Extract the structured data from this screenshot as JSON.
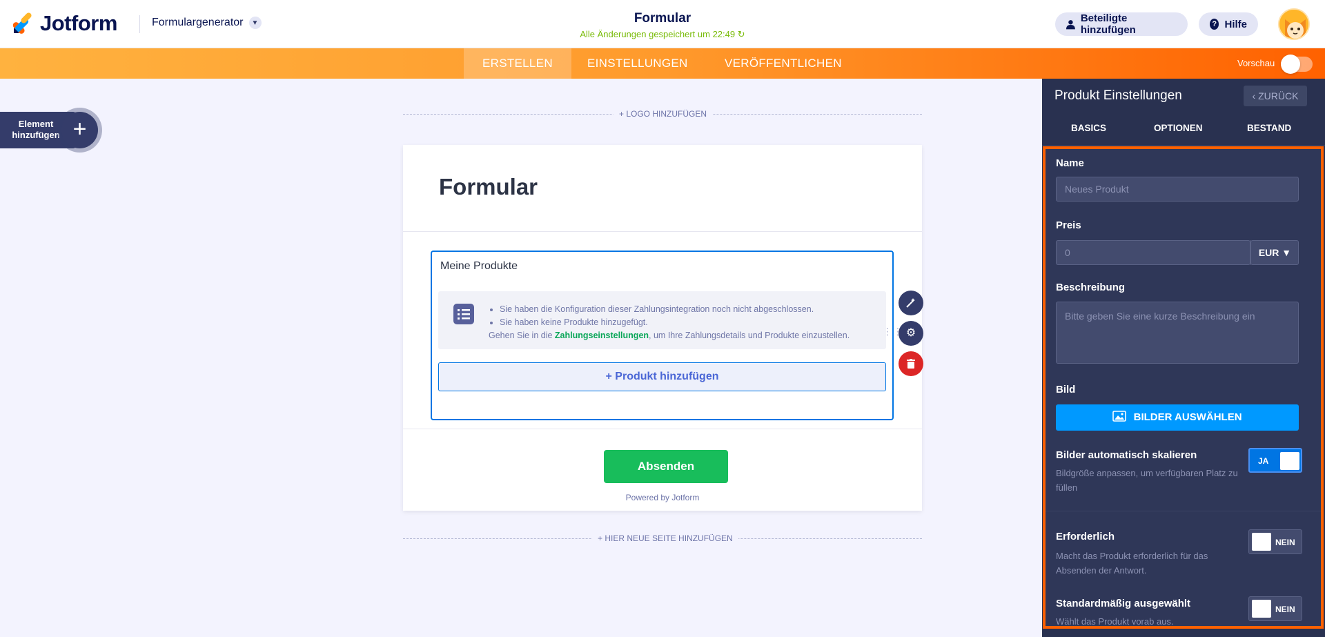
{
  "header": {
    "logo_text": "Jotform",
    "app_switcher": "Formulargenerator",
    "form_title": "Formular",
    "save_status": "Alle Änderungen gespeichert um 22:49",
    "invite_label": "Beteiligte hinzufügen",
    "help_label": "Hilfe"
  },
  "nav": {
    "tabs": [
      {
        "label": "ERSTELLEN",
        "active": true
      },
      {
        "label": "EINSTELLUNGEN",
        "active": false
      },
      {
        "label": "VERÖFFENTLICHEN",
        "active": false
      }
    ],
    "preview_label": "Vorschau"
  },
  "builder": {
    "add_element_label": "Element hinzufügen",
    "add_logo": "+ LOGO HINZUFÜGEN",
    "add_page": "+ HIER NEUE SEITE HINZUFÜGEN",
    "form_heading": "Formular",
    "products_label": "Meine Produkte",
    "warning_items": [
      "Sie haben die Konfiguration dieser Zahlungsintegration noch nicht abgeschlossen.",
      "Sie haben keine Produkte hinzugefügt."
    ],
    "warning_prefix": "Gehen Sie in die ",
    "warning_link": "Zahlungseinstellungen",
    "warning_suffix": ", um Ihre Zahlungsdetails und Produkte einzustellen.",
    "add_product": "+ Produkt hinzufügen",
    "submit_label": "Absenden",
    "powered_by": "Powered by Jotform"
  },
  "panel": {
    "title": "Produkt Einstellungen",
    "back_label": "ZURÜCK",
    "tabs": [
      "BASICS",
      "OPTIONEN",
      "BESTAND"
    ],
    "name_label": "Name",
    "name_placeholder": "Neues Produkt",
    "price_label": "Preis",
    "price_placeholder": "0",
    "currency": "EUR",
    "description_label": "Beschreibung",
    "description_placeholder": "Bitte geben Sie eine kurze Beschreibung ein",
    "image_label": "Bild",
    "image_button": "BILDER AUSWÄHLEN",
    "autoscale_label": "Bilder automatisch skalieren",
    "autoscale_desc": "Bildgröße anpassen, um verfügbaren Platz zu füllen",
    "autoscale_value": "JA",
    "required_label": "Erforderlich",
    "required_desc": "Macht das Produkt erforderlich für das Absenden der Antwort.",
    "required_value": "NEIN",
    "default_label": "Standardmäßig ausgewählt",
    "default_desc": "Wählt das Produkt vorab aus.",
    "default_value": "NEIN"
  },
  "colors": {
    "accent_orange": "#ff6100",
    "brand_navy": "#0a1551",
    "submit_green": "#18bd5b",
    "panel_bg": "#293150",
    "image_button_blue": "#0099ff"
  }
}
